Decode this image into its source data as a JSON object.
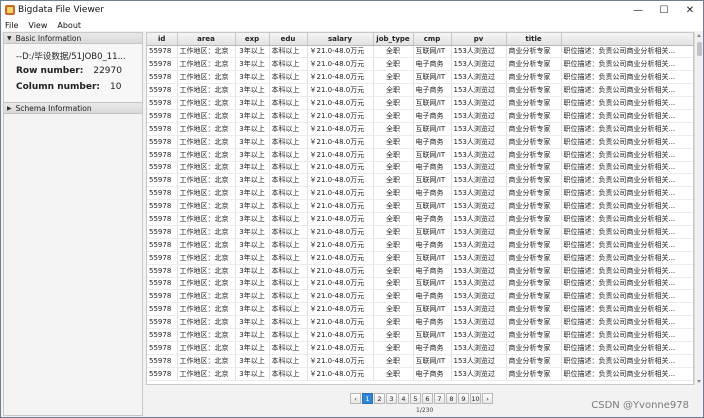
{
  "window": {
    "title": "Bigdata File Viewer",
    "minimize_glyph": "—",
    "maximize_glyph": "☐",
    "close_glyph": "✕",
    "app_icon": "app-logo-icon"
  },
  "menu": [
    "File",
    "View",
    "About"
  ],
  "left_panel": {
    "basic_header": "Basic Information",
    "path": "--D:/毕设数据/51JOB0_11...",
    "row_label": "Row number:",
    "row_value": "22970",
    "col_label": "Column number:",
    "col_value": "10",
    "schema_header": "Schema Information"
  },
  "table": {
    "columns": [
      "id",
      "area",
      "exp",
      "edu",
      "salary",
      "job_type",
      "cmp",
      "pv",
      "title",
      ""
    ],
    "rows": [
      [
        "55978",
        "工作地区：北京",
        "3年以上",
        "本科以上",
        "￥21.0-48.0万元",
        "全职",
        "互联网/IT",
        "153人浏览过",
        "商业分析专家",
        "职位描述：负责公司商业分析相关..."
      ],
      [
        "55978",
        "工作地区：北京",
        "3年以上",
        "本科以上",
        "￥21.0-48.0万元",
        "全职",
        "电子商务",
        "153人浏览过",
        "商业分析专家",
        "职位描述：负责公司商业分析相关..."
      ],
      [
        "55978",
        "工作地区：北京",
        "3年以上",
        "本科以上",
        "￥21.0-48.0万元",
        "全职",
        "互联网/IT",
        "153人浏览过",
        "商业分析专家",
        "职位描述：负责公司商业分析相关..."
      ],
      [
        "55978",
        "工作地区：北京",
        "3年以上",
        "本科以上",
        "￥21.0-48.0万元",
        "全职",
        "电子商务",
        "153人浏览过",
        "商业分析专家",
        "职位描述：负责公司商业分析相关..."
      ],
      [
        "55978",
        "工作地区：北京",
        "3年以上",
        "本科以上",
        "￥21.0-48.0万元",
        "全职",
        "互联网/IT",
        "153人浏览过",
        "商业分析专家",
        "职位描述：负责公司商业分析相关..."
      ],
      [
        "55978",
        "工作地区：北京",
        "3年以上",
        "本科以上",
        "￥21.0-48.0万元",
        "全职",
        "电子商务",
        "153人浏览过",
        "商业分析专家",
        "职位描述：负责公司商业分析相关..."
      ],
      [
        "55978",
        "工作地区：北京",
        "3年以上",
        "本科以上",
        "￥21.0-48.0万元",
        "全职",
        "互联网/IT",
        "153人浏览过",
        "商业分析专家",
        "职位描述：负责公司商业分析相关..."
      ],
      [
        "55978",
        "工作地区：北京",
        "3年以上",
        "本科以上",
        "￥21.0-48.0万元",
        "全职",
        "电子商务",
        "153人浏览过",
        "商业分析专家",
        "职位描述：负责公司商业分析相关..."
      ],
      [
        "55978",
        "工作地区：北京",
        "3年以上",
        "本科以上",
        "￥21.0-48.0万元",
        "全职",
        "互联网/IT",
        "153人浏览过",
        "商业分析专家",
        "职位描述：负责公司商业分析相关..."
      ],
      [
        "55978",
        "工作地区：北京",
        "3年以上",
        "本科以上",
        "￥21.0-48.0万元",
        "全职",
        "电子商务",
        "153人浏览过",
        "商业分析专家",
        "职位描述：负责公司商业分析相关..."
      ],
      [
        "55978",
        "工作地区：北京",
        "3年以上",
        "本科以上",
        "￥21.0-48.0万元",
        "全职",
        "互联网/IT",
        "153人浏览过",
        "商业分析专家",
        "职位描述：负责公司商业分析相关..."
      ],
      [
        "55978",
        "工作地区：北京",
        "3年以上",
        "本科以上",
        "￥21.0-48.0万元",
        "全职",
        "电子商务",
        "153人浏览过",
        "商业分析专家",
        "职位描述：负责公司商业分析相关..."
      ],
      [
        "55978",
        "工作地区：北京",
        "3年以上",
        "本科以上",
        "￥21.0-48.0万元",
        "全职",
        "互联网/IT",
        "153人浏览过",
        "商业分析专家",
        "职位描述：负责公司商业分析相关..."
      ],
      [
        "55978",
        "工作地区：北京",
        "3年以上",
        "本科以上",
        "￥21.0-48.0万元",
        "全职",
        "电子商务",
        "153人浏览过",
        "商业分析专家",
        "职位描述：负责公司商业分析相关..."
      ],
      [
        "55978",
        "工作地区：北京",
        "3年以上",
        "本科以上",
        "￥21.0-48.0万元",
        "全职",
        "互联网/IT",
        "153人浏览过",
        "商业分析专家",
        "职位描述：负责公司商业分析相关..."
      ],
      [
        "55978",
        "工作地区：北京",
        "3年以上",
        "本科以上",
        "￥21.0-48.0万元",
        "全职",
        "电子商务",
        "153人浏览过",
        "商业分析专家",
        "职位描述：负责公司商业分析相关..."
      ],
      [
        "55978",
        "工作地区：北京",
        "3年以上",
        "本科以上",
        "￥21.0-48.0万元",
        "全职",
        "互联网/IT",
        "153人浏览过",
        "商业分析专家",
        "职位描述：负责公司商业分析相关..."
      ],
      [
        "55978",
        "工作地区：北京",
        "3年以上",
        "本科以上",
        "￥21.0-48.0万元",
        "全职",
        "电子商务",
        "153人浏览过",
        "商业分析专家",
        "职位描述：负责公司商业分析相关..."
      ],
      [
        "55978",
        "工作地区：北京",
        "3年以上",
        "本科以上",
        "￥21.0-48.0万元",
        "全职",
        "互联网/IT",
        "153人浏览过",
        "商业分析专家",
        "职位描述：负责公司商业分析相关..."
      ],
      [
        "55978",
        "工作地区：北京",
        "3年以上",
        "本科以上",
        "￥21.0-48.0万元",
        "全职",
        "电子商务",
        "153人浏览过",
        "商业分析专家",
        "职位描述：负责公司商业分析相关..."
      ],
      [
        "55978",
        "工作地区：北京",
        "3年以上",
        "本科以上",
        "￥21.0-48.0万元",
        "全职",
        "互联网/IT",
        "153人浏览过",
        "商业分析专家",
        "职位描述：负责公司商业分析相关..."
      ],
      [
        "55978",
        "工作地区：北京",
        "3年以上",
        "本科以上",
        "￥21.0-48.0万元",
        "全职",
        "电子商务",
        "153人浏览过",
        "商业分析专家",
        "职位描述：负责公司商业分析相关..."
      ],
      [
        "55978",
        "工作地区：北京",
        "3年以上",
        "本科以上",
        "￥21.0-48.0万元",
        "全职",
        "互联网/IT",
        "153人浏览过",
        "商业分析专家",
        "职位描述：负责公司商业分析相关..."
      ],
      [
        "55978",
        "工作地区：北京",
        "3年以上",
        "本科以上",
        "￥21.0-48.0万元",
        "全职",
        "电子商务",
        "153人浏览过",
        "商业分析专家",
        "职位描述：负责公司商业分析相关..."
      ],
      [
        "55978",
        "工作地区：北京",
        "3年以上",
        "本科以上",
        "￥21.0-48.0万元",
        "全职",
        "互联网/IT",
        "153人浏览过",
        "商业分析专家",
        "职位描述：负责公司商业分析相关..."
      ],
      [
        "55978",
        "工作地区：北京",
        "3年以上",
        "本科以上",
        "￥21.0-48.0万元",
        "全职",
        "电子商务",
        "153人浏览过",
        "商业分析专家",
        "职位描述：负责公司商业分析相关..."
      ]
    ]
  },
  "pagination": {
    "prev_glyph": "‹",
    "next_glyph": "›",
    "pages": [
      "1",
      "2",
      "3",
      "4",
      "5",
      "6",
      "7",
      "8",
      "9",
      "10"
    ],
    "active_page": "1",
    "page_indicator": "1/230"
  },
  "watermark": "CSDN @Yvonne978"
}
